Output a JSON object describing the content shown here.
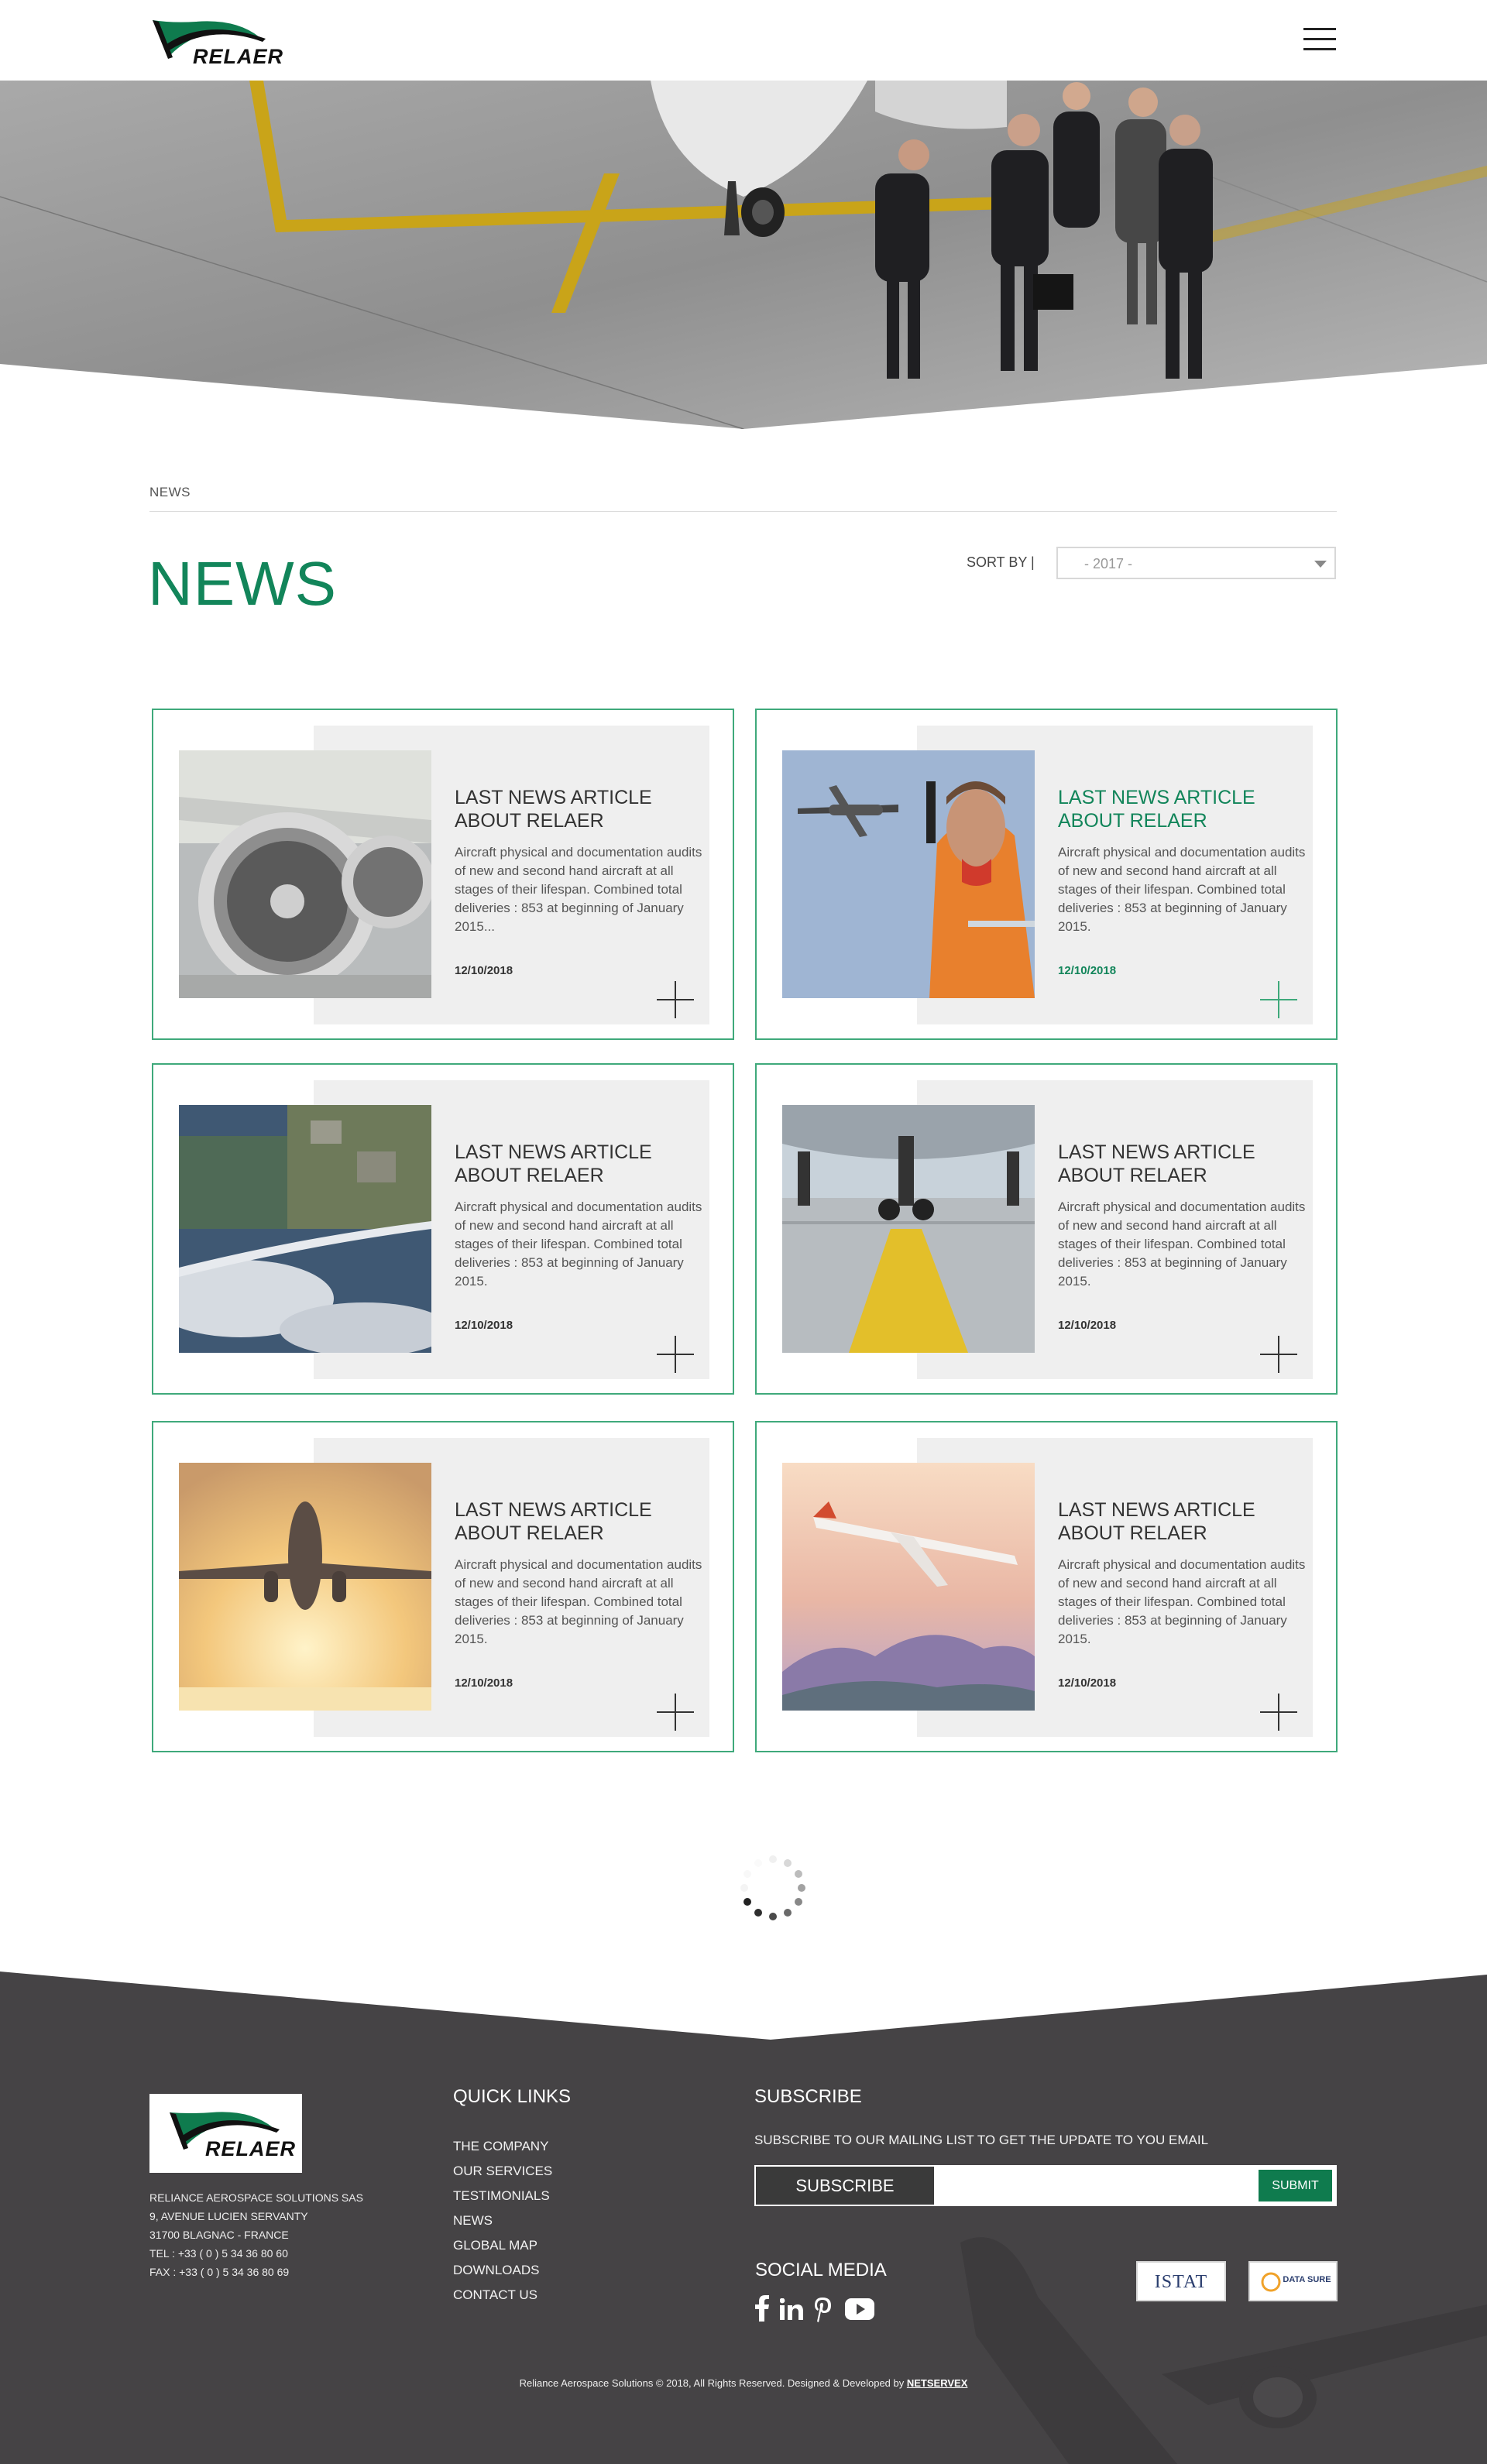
{
  "brand": {
    "name": "RELAER",
    "colors": {
      "primary_green": "#12855a",
      "border_green": "#3fa97b",
      "footer_bg": "#454345",
      "submit_green": "#0f7b4e"
    }
  },
  "header": {
    "logo_text": "RELAER",
    "menu_icon": "hamburger-menu-icon"
  },
  "breadcrumb": "NEWS",
  "page_title": "NEWS",
  "sort": {
    "label": "SORT BY |",
    "selected": "-  2017  -"
  },
  "articles": [
    {
      "title": "LAST NEWS ARTICLE ABOUT RELAER",
      "excerpt": "Aircraft physical and documentation audits of new and second hand aircraft at all stages of their lifespan. Combined total deliveries : 853 at beginning of January 2015...",
      "date": "12/10/2018",
      "image": "jet-engine-photo"
    },
    {
      "title": "LAST NEWS ARTICLE ABOUT RELAER",
      "excerpt": "Aircraft physical and documentation audits of new and second hand aircraft at all stages of their lifespan. Combined total deliveries : 853 at beginning of January 2015.",
      "date": "12/10/2018",
      "image": "ground-crew-radio-photo"
    },
    {
      "title": "LAST NEWS ARTICLE ABOUT RELAER",
      "excerpt": "Aircraft physical and documentation audits of new and second hand aircraft at all stages of their lifespan. Combined total deliveries : 853 at beginning of January 2015.",
      "date": "12/10/2018",
      "image": "aerial-wing-view-photo"
    },
    {
      "title": "LAST NEWS ARTICLE ABOUT RELAER",
      "excerpt": "Aircraft physical and documentation audits of new and second hand aircraft at all stages of their lifespan. Combined total deliveries : 853 at beginning of January 2015.",
      "date": "12/10/2018",
      "image": "landing-gear-runway-photo"
    },
    {
      "title": "LAST NEWS ARTICLE ABOUT RELAER",
      "excerpt": "Aircraft physical and documentation audits of new and second hand aircraft at all stages of their lifespan. Combined total deliveries : 853 at beginning of January 2015.",
      "date": "12/10/2018",
      "image": "plane-takeoff-sunset-photo"
    },
    {
      "title": "LAST NEWS ARTICLE ABOUT RELAER",
      "excerpt": "Aircraft physical and documentation audits of new and second hand aircraft at all stages of their lifespan. Combined total deliveries : 853 at beginning of January 2015.",
      "date": "12/10/2018",
      "image": "plane-over-mountains-photo"
    }
  ],
  "footer": {
    "logo_text": "RELAER",
    "address": [
      "RELIANCE AEROSPACE SOLUTIONS SAS",
      "9, AVENUE LUCIEN SERVANTY",
      "31700 BLAGNAC - FRANCE",
      "TEL : +33 ( 0 ) 5 34 36 80 60",
      "FAX : +33 ( 0 ) 5 34 36 80 69"
    ],
    "quick_links_heading": "QUICK LINKS",
    "quick_links": [
      "THE COMPANY",
      "OUR SERVICES",
      "TESTIMONIALS",
      "NEWS",
      "GLOBAL MAP",
      "DOWNLOADS",
      "CONTACT US"
    ],
    "subscribe_heading": "SUBSCRIBE",
    "subscribe_text": "SUBSCRIBE TO OUR MAILING LIST TO GET THE UPDATE TO YOU EMAIL",
    "subscribe_label": "SUBSCRIBE",
    "email_placeholder": "",
    "submit_label": "SUBMIT",
    "social_heading": "SOCIAL MEDIA",
    "social_icons": [
      "facebook-icon",
      "linkedin-icon",
      "pinterest-icon",
      "youtube-icon"
    ],
    "partners": [
      "ISTAT",
      "DATA SURE"
    ],
    "copyright": "Reliance Aerospace Solutions © 2018, All Rights Reserved. Designed & Developed by",
    "developer": "NETSERVEX"
  }
}
